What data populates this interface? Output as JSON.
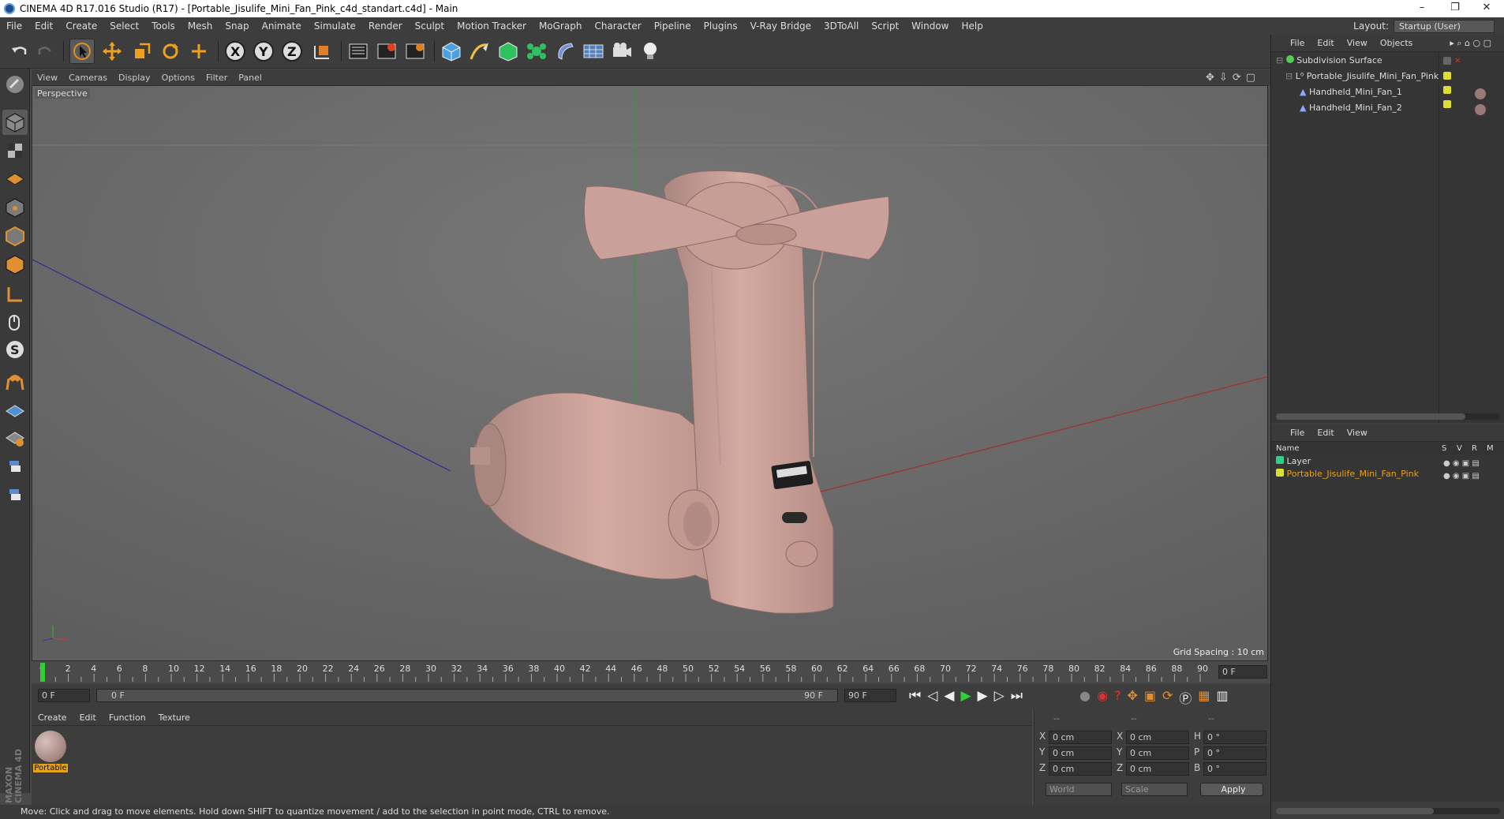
{
  "window": {
    "title": "CINEMA 4D R17.016 Studio (R17) - [Portable_Jisulife_Mini_Fan_Pink_c4d_standart.c4d] - Main",
    "minimize": "–",
    "restore": "❐",
    "close": "✕"
  },
  "menu": [
    "File",
    "Edit",
    "Create",
    "Select",
    "Tools",
    "Mesh",
    "Snap",
    "Animate",
    "Simulate",
    "Render",
    "Sculpt",
    "Motion Tracker",
    "MoGraph",
    "Character",
    "Pipeline",
    "Plugins",
    "V-Ray Bridge",
    "3DToAll",
    "Script",
    "Window",
    "Help"
  ],
  "layout": {
    "label": "Layout:",
    "value": "Startup (User)"
  },
  "toolbar_axes": [
    "X",
    "Y",
    "Z"
  ],
  "viewport": {
    "menu": [
      "View",
      "Cameras",
      "Display",
      "Options",
      "Filter",
      "Panel"
    ],
    "label": "Perspective",
    "grid_spacing": "Grid Spacing : 10 cm"
  },
  "timeline": {
    "ticks": [
      "0",
      "2",
      "4",
      "6",
      "8",
      "10",
      "12",
      "14",
      "16",
      "18",
      "20",
      "22",
      "24",
      "26",
      "28",
      "30",
      "32",
      "34",
      "36",
      "38",
      "40",
      "42",
      "44",
      "46",
      "48",
      "50",
      "52",
      "54",
      "56",
      "58",
      "60",
      "62",
      "64",
      "66",
      "68",
      "70",
      "72",
      "74",
      "76",
      "78",
      "80",
      "82",
      "84",
      "86",
      "88",
      "90"
    ],
    "frame_field": "0 F",
    "current": "0 F",
    "slider_start": "0 F",
    "slider_end": "90 F",
    "end_field": "90 F"
  },
  "materials": {
    "menu": [
      "Create",
      "Edit",
      "Function",
      "Texture"
    ],
    "items": [
      {
        "name": "Portable"
      }
    ]
  },
  "coords": {
    "header": [
      "--",
      "--",
      "--"
    ],
    "rows": [
      {
        "a": "X",
        "v1": "0 cm",
        "b": "X",
        "v2": "0 cm",
        "c": "H",
        "v3": "0 °"
      },
      {
        "a": "Y",
        "v1": "0 cm",
        "b": "Y",
        "v2": "0 cm",
        "c": "P",
        "v3": "0 °"
      },
      {
        "a": "Z",
        "v1": "0 cm",
        "b": "Z",
        "v2": "0 cm",
        "c": "B",
        "v3": "0 °"
      }
    ],
    "world": "World",
    "scale": "Scale",
    "apply": "Apply"
  },
  "objects_panel": {
    "menu": [
      "File",
      "Edit",
      "View",
      "Objects"
    ],
    "items": [
      {
        "name": "Subdivision Surface",
        "indent": 0,
        "color": "#55cc55"
      },
      {
        "name": "Portable_Jisulife_Mini_Fan_Pink",
        "indent": 1,
        "color": "#dddddd"
      },
      {
        "name": "Handheld_Mini_Fan_1",
        "indent": 2,
        "color": "#88aaff"
      },
      {
        "name": "Handheld_Mini_Fan_2",
        "indent": 2,
        "color": "#88aaff"
      }
    ]
  },
  "layers_panel": {
    "menu": [
      "File",
      "Edit",
      "View"
    ],
    "columns": [
      "Name",
      "S",
      "V",
      "R",
      "M"
    ],
    "items": [
      {
        "name": "Layer",
        "color": "#33cc88"
      },
      {
        "name": "Portable_Jisulife_Mini_Fan_Pink",
        "color": "#dddd33"
      }
    ]
  },
  "status": "Move: Click and drag to move elements. Hold down SHIFT to quantize movement / add to the selection in point mode, CTRL to remove.",
  "brand": "MAXON CINEMA 4D",
  "colors": {
    "model": "#c9a19a",
    "model_shade": "#a47f78",
    "viewport_bg": "#6e6e6e",
    "axis_x": "#c04040",
    "axis_y": "#40b040",
    "axis_z": "#3030b0",
    "accent": "#e8a21a"
  }
}
